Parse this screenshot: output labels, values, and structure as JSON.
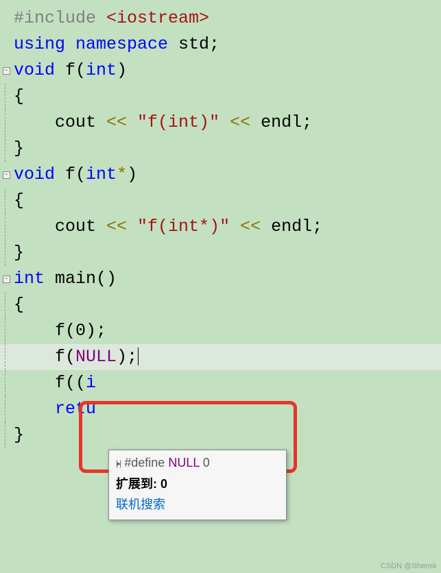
{
  "code": {
    "line1_preproc": "#include ",
    "line1_angle": "<iostream>",
    "line2_using": "using",
    "line2_ns": " namespace",
    "line2_std": " std;",
    "line3_void": "void",
    "line3_fn": " f",
    "line3_paren_open": "(",
    "line3_int": "int",
    "line3_paren_close": ")",
    "line4_brace": "{",
    "line5_indent": "    ",
    "line5_cout": "cout ",
    "line5_op1": "<< ",
    "line5_str": "\"f(int)\"",
    "line5_op2": " << ",
    "line5_endl": "endl",
    "line5_semi": ";",
    "line6_brace": "}",
    "line7_void": "void",
    "line7_fn": " f",
    "line7_paren_open": "(",
    "line7_int": "int",
    "line7_star": "*",
    "line7_paren_close": ")",
    "line8_brace": "{",
    "line9_indent": "    ",
    "line9_cout": "cout ",
    "line9_op1": "<< ",
    "line9_str": "\"f(int*)\"",
    "line9_op2": " << ",
    "line9_endl": "endl",
    "line9_semi": ";",
    "line10_brace": "}",
    "line11_int": "int",
    "line11_main": " main",
    "line11_parens": "()",
    "line12_brace": "{",
    "line13_indent": "    ",
    "line13_f": "f",
    "line13_arg": "(0);",
    "line14_indent": "    ",
    "line14_f": "f",
    "line14_open": "(",
    "line14_null": "NULL",
    "line14_close": ");",
    "line15_indent": "    ",
    "line15_f": "f",
    "line15_open": "((",
    "line15_i": "i",
    "line16_indent": "    ",
    "line16_retu": "retu",
    "line17_brace": "}"
  },
  "tooltip": {
    "define_kw": "#define ",
    "define_name": "NULL",
    "define_val": " 0",
    "expand_label": "扩展到: ",
    "expand_val": "0",
    "search_link": "联机搜索"
  },
  "watermark": "CSDN @Shensk"
}
